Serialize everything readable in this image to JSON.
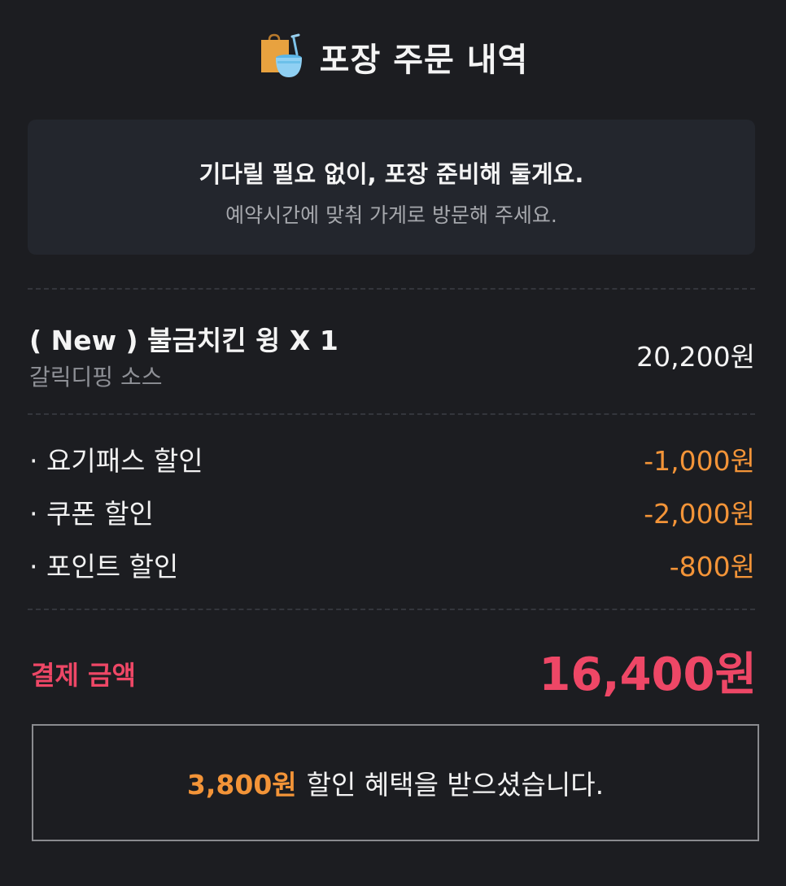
{
  "header": {
    "title": "포장 주문 내역",
    "icon": "takeout-bag-icon"
  },
  "notice": {
    "main": "기다릴 필요 없이, 포장 준비해 둘게요.",
    "sub": "예약시간에 맞춰 가게로 방문해 주세요."
  },
  "order_item": {
    "name": "( New ) 불금치킨 윙 X 1",
    "option": "갈릭디핑 소스",
    "price": "20,200원"
  },
  "discounts": [
    {
      "label": "· 요기패스 할인",
      "value": "-1,000원"
    },
    {
      "label": "· 쿠폰 할인",
      "value": "-2,000원"
    },
    {
      "label": "· 포인트 할인",
      "value": "-800원"
    }
  ],
  "total": {
    "label": "결제 금액",
    "value": "16,400원"
  },
  "benefit": {
    "amount": "3,800원",
    "text": "할인 혜택을 받으셨습니다."
  },
  "colors": {
    "background": "#1c1d21",
    "notice_bg": "#23262d",
    "accent_orange": "#f39438",
    "accent_red": "#ee4766"
  }
}
